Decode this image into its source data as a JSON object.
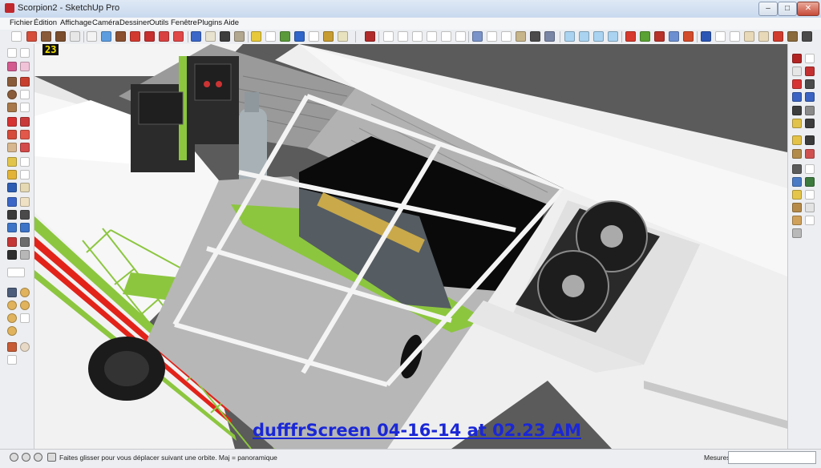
{
  "window": {
    "title": "Scorpion2 - SketchUp Pro",
    "minimize_glyph": "–",
    "maximize_glyph": "□",
    "close_glyph": "✕"
  },
  "menu": [
    "Fichier",
    "Édition",
    "Affichage",
    "Caméra",
    "Dessiner",
    "Outils",
    "Fenêtre",
    "Plugins",
    "Aide"
  ],
  "viewport": {
    "frame_counter": "23",
    "watermark": "dufffrScreen 04-16-14 at 02.23 AM"
  },
  "statusbar": {
    "hint": "Faites glisser pour vous déplacer suivant une orbite.  Maj = panoramique",
    "measures_label": "Mesures",
    "measures_value": ""
  },
  "colors": {
    "accent_green": "#8cc63f",
    "stripe_red": "#e2231a",
    "background_gray": "#5a5a5a"
  }
}
